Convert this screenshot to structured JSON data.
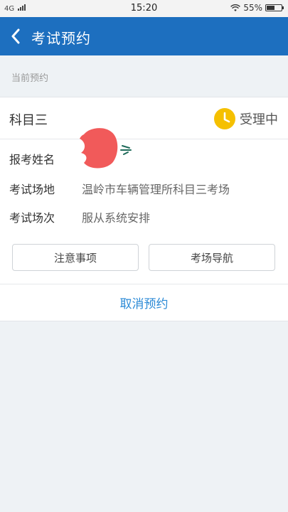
{
  "status_bar": {
    "network": "4G",
    "time": "15:20",
    "battery": "55%",
    "battery_level": 0.55
  },
  "header": {
    "title": "考试预约"
  },
  "section": {
    "label": "当前预约"
  },
  "appointment": {
    "subject": "科目三",
    "status": "受理中",
    "rows": [
      {
        "key": "报考姓名",
        "value": ""
      },
      {
        "key": "考试场地",
        "value": "温岭市车辆管理所科目三考场"
      },
      {
        "key": "考试场次",
        "value": "服从系统安排"
      }
    ],
    "buttons": {
      "notes": "注意事项",
      "navigation": "考场导航"
    },
    "cancel": "取消预约"
  },
  "colors": {
    "header_bg": "#1d6fbf",
    "accent_link": "#2b8ad6",
    "status_icon": "#f5c000",
    "redaction": "#f15a5a"
  },
  "icons": [
    "back-chevron-icon",
    "clock-icon",
    "wifi-icon",
    "signal-icon",
    "battery-icon"
  ]
}
